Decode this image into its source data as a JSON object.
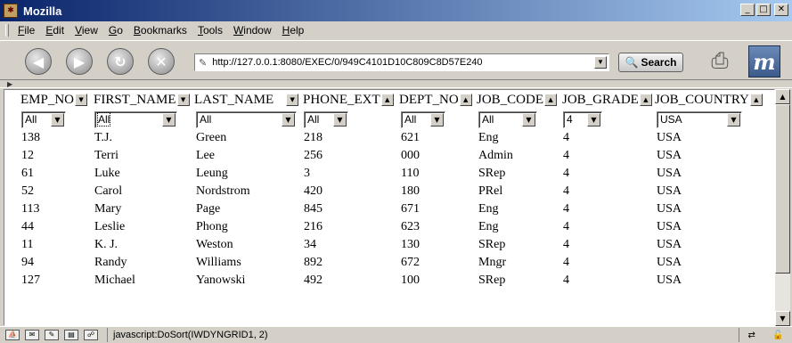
{
  "window": {
    "title": "Mozilla",
    "minimize": "_",
    "maximize": "□",
    "close": "✕"
  },
  "menu": [
    "File",
    "Edit",
    "View",
    "Go",
    "Bookmarks",
    "Tools",
    "Window",
    "Help"
  ],
  "nav": {
    "back": "◀",
    "forward": "▶",
    "reload": "↻",
    "stop": "✕",
    "url": "http://127.0.0.1:8080/EXEC/0/949C4101D10C809C8D57E240",
    "search_label": "Search"
  },
  "grid": {
    "columns": [
      {
        "name": "EMP_NO",
        "sort": "▼",
        "filter": "All"
      },
      {
        "name": "FIRST_NAME",
        "sort": "▼",
        "filter": "All"
      },
      {
        "name": "LAST_NAME",
        "sort": "▼",
        "filter": "All"
      },
      {
        "name": "PHONE_EXT",
        "sort": "▲",
        "filter": "All"
      },
      {
        "name": "DEPT_NO",
        "sort": "▲",
        "filter": "All"
      },
      {
        "name": "JOB_CODE",
        "sort": "▲",
        "filter": "All"
      },
      {
        "name": "JOB_GRADE",
        "sort": "▲",
        "filter": "4"
      },
      {
        "name": "JOB_COUNTRY",
        "sort": "▲",
        "filter": "USA"
      }
    ],
    "rows": [
      [
        "138",
        "T.J.",
        "Green",
        "218",
        "621",
        "Eng",
        "4",
        "USA"
      ],
      [
        "12",
        "Terri",
        "Lee",
        "256",
        "000",
        "Admin",
        "4",
        "USA"
      ],
      [
        "61",
        "Luke",
        "Leung",
        "3",
        "110",
        "SRep",
        "4",
        "USA"
      ],
      [
        "52",
        "Carol",
        "Nordstrom",
        "420",
        "180",
        "PRel",
        "4",
        "USA"
      ],
      [
        "113",
        "Mary",
        "Page",
        "845",
        "671",
        "Eng",
        "4",
        "USA"
      ],
      [
        "44",
        "Leslie",
        "Phong",
        "216",
        "623",
        "Eng",
        "4",
        "USA"
      ],
      [
        "11",
        "K. J.",
        "Weston",
        "34",
        "130",
        "SRep",
        "4",
        "USA"
      ],
      [
        "94",
        "Randy",
        "Williams",
        "892",
        "672",
        "Mngr",
        "4",
        "USA"
      ],
      [
        "127",
        "Michael",
        "Yanowski",
        "492",
        "100",
        "SRep",
        "4",
        "USA"
      ]
    ]
  },
  "status": {
    "text": "javascript:DoSort(IWDYNGRID1, 2)"
  }
}
